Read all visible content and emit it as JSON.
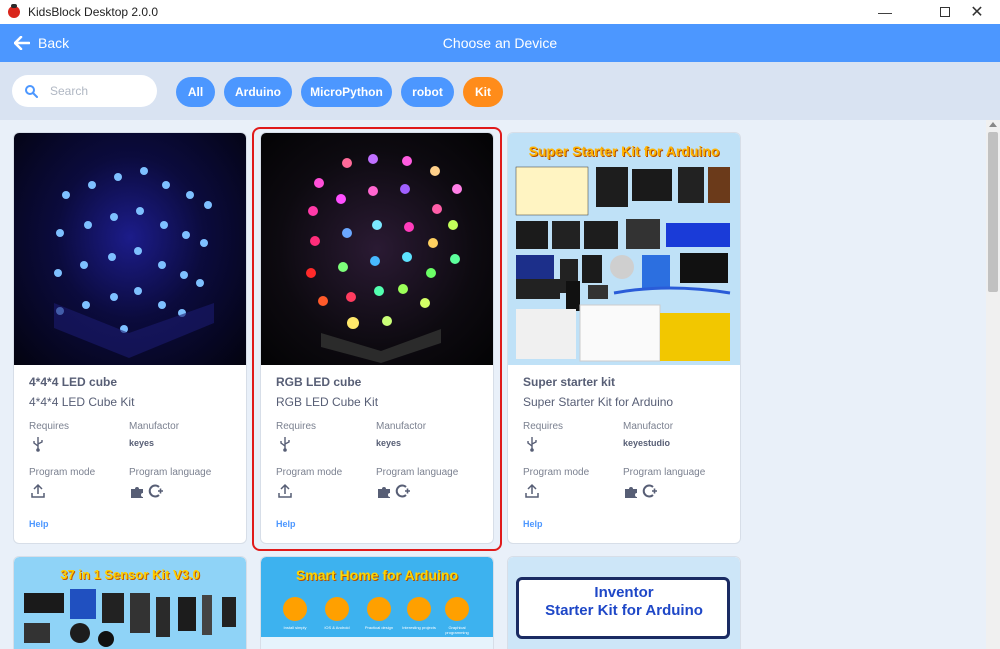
{
  "window": {
    "title": "KidsBlock Desktop 2.0.0",
    "minimize_icon": "minimize-icon",
    "maximize_icon": "maximize-icon",
    "close_icon": "close-icon"
  },
  "header": {
    "back_label": "Back",
    "title": "Choose an Device"
  },
  "search": {
    "placeholder": "Search",
    "value": ""
  },
  "filters": [
    {
      "label": "All",
      "color": "#4c97ff"
    },
    {
      "label": "Arduino",
      "color": "#4c97ff"
    },
    {
      "label": "MicroPython",
      "color": "#4c97ff"
    },
    {
      "label": "robot",
      "color": "#4c97ff"
    },
    {
      "label": "Kit",
      "color": "#ff8c1a",
      "selected": true
    }
  ],
  "labels": {
    "requires": "Requires",
    "manufacturer": "Manufactor",
    "program_mode": "Program mode",
    "program_language": "Program language",
    "help": "Help"
  },
  "cards": [
    {
      "name": "4*4*4 LED cube",
      "description": "4*4*4 LED Cube Kit",
      "manufacturer": "keyes"
    },
    {
      "name": "RGB LED cube",
      "description": "RGB LED Cube Kit",
      "manufacturer": "keyes",
      "selected": true
    },
    {
      "name": "Super starter kit",
      "description": "Super Starter Kit for Arduino",
      "manufacturer": "keyestudio",
      "banner": "Super Starter Kit for Arduino"
    }
  ],
  "partial_cards": [
    {
      "banner": "37 in 1 Sensor Kit V3.0"
    },
    {
      "banner": "Smart Home for Arduino",
      "features": [
        "Install simply",
        "iOS & Android",
        "Practical design",
        "Interesting projects",
        "Graphical programming"
      ]
    },
    {
      "banner_line1": "Inventor",
      "banner_line2": "Starter Kit for Arduino"
    }
  ],
  "colors": {
    "accent": "#4c97ff",
    "kit": "#ff8c1a",
    "selection": "#e01a1a",
    "text": "#575e75"
  }
}
